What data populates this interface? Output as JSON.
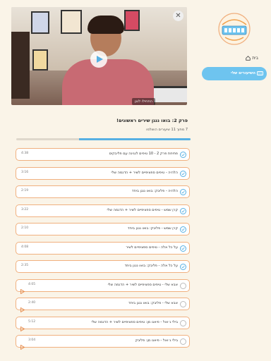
{
  "video": {
    "switch_label": "התחילו לנגן",
    "close_label": "✕"
  },
  "chapter": {
    "title": "פרק 2: בואו ננגן שירים ראשונים!",
    "subtitle": "7 מתוך 11 שיעורים הושלמו",
    "progress_fraction": 0.64
  },
  "lessons": [
    {
      "title": "פתיחת פרק 2 - 10 טיפים לנגינה עם פליבקים",
      "duration": "4:38",
      "done": true,
      "play": false
    },
    {
      "title": "הלהיה - טיפים ספציפיים לשיר + הדגמה שלי",
      "duration": "3:16",
      "done": true,
      "play": false
    },
    {
      "title": "הלהיה - פליבק: בואו ננגן ביחד",
      "duration": "2:19",
      "done": true,
      "play": false
    },
    {
      "title": "קרן שמש - טיפים ספציפיים לשיר + הדגמה שלי",
      "duration": "3:22",
      "done": true,
      "play": false
    },
    {
      "title": "קרן שמש - פליבק: בואו ננגן ביחד",
      "duration": "2:10",
      "done": true,
      "play": false
    },
    {
      "title": "על כל אלה - טיפים ספציפיים לשיר",
      "duration": "4:08",
      "done": true,
      "play": false
    },
    {
      "title": "על כל אלה - פליבק: בואו ננגן ביחד",
      "duration": "2:35",
      "done": true,
      "play": false
    },
    {
      "title": "אבא שלי - טיפים ספציפיים לשיר + הדגמה שלי",
      "duration": "4:05",
      "done": false,
      "play": true
    },
    {
      "title": "אבא שלי - פליבק: בואו ננגן ביחד",
      "duration": "2:40",
      "done": false,
      "play": true
    },
    {
      "title": "בילי ג׳ואל - פיאנו מן: טיפים ספציפיים לשיר + הדגמה שלי",
      "duration": "5:12",
      "done": false,
      "play": true
    },
    {
      "title": "בילי ג׳ואל - פיאנו מן: פליבק",
      "duration": "3:04",
      "done": false,
      "play": true
    }
  ],
  "sidebar": {
    "home_label": "בית",
    "courses_label": "השיעורים שלי"
  },
  "colors": {
    "accent": "#57b0e3",
    "lesson_border": "#f0b07f",
    "background": "#faf4e8"
  }
}
